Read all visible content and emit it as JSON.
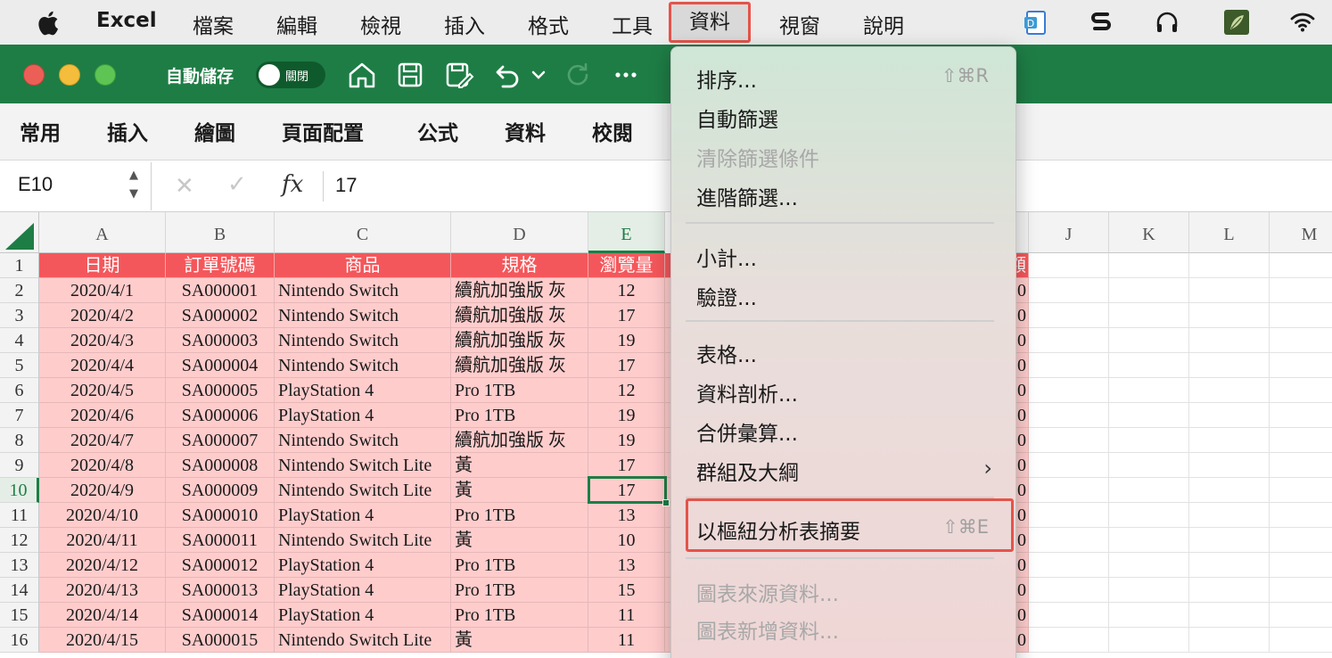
{
  "menubar": {
    "app": "Excel",
    "items": [
      "檔案",
      "編輯",
      "檢視",
      "插入",
      "格式",
      "工具",
      "資料",
      "視窗",
      "說明"
    ],
    "active": "資料"
  },
  "titlebar": {
    "autosave_label": "自動儲存",
    "toggle_label": "關閉"
  },
  "ribbon": {
    "tabs": [
      "常用",
      "插入",
      "繪圖",
      "頁面配置",
      "公式",
      "資料",
      "校閱"
    ]
  },
  "formula_bar": {
    "name_box": "E10",
    "fx": "fx",
    "value": "17"
  },
  "grid": {
    "columns": [
      "A",
      "B",
      "C",
      "D",
      "E",
      "J",
      "K",
      "L",
      "M"
    ],
    "selected_column": "E",
    "selected_row": "10",
    "header_row": [
      "日期",
      "訂單號碼",
      "商品",
      "規格",
      "瀏覽量"
    ],
    "rows": [
      {
        "n": "1"
      },
      {
        "n": "2",
        "cells": [
          "2020/4/1",
          "SA000001",
          "Nintendo Switch",
          "續航加強版 灰",
          "12"
        ]
      },
      {
        "n": "3",
        "cells": [
          "2020/4/2",
          "SA000002",
          "Nintendo Switch",
          "續航加強版 灰",
          "17"
        ]
      },
      {
        "n": "4",
        "cells": [
          "2020/4/3",
          "SA000003",
          "Nintendo Switch",
          "續航加強版 灰",
          "19"
        ]
      },
      {
        "n": "5",
        "cells": [
          "2020/4/4",
          "SA000004",
          "Nintendo Switch",
          "續航加強版 灰",
          "17"
        ]
      },
      {
        "n": "6",
        "cells": [
          "2020/4/5",
          "SA000005",
          "PlayStation 4",
          "Pro 1TB",
          "12"
        ]
      },
      {
        "n": "7",
        "cells": [
          "2020/4/6",
          "SA000006",
          "PlayStation 4",
          "Pro 1TB",
          "19"
        ]
      },
      {
        "n": "8",
        "cells": [
          "2020/4/7",
          "SA000007",
          "Nintendo Switch",
          "續航加強版 灰",
          "19"
        ]
      },
      {
        "n": "9",
        "cells": [
          "2020/4/8",
          "SA000008",
          "Nintendo Switch Lite",
          "黃",
          "17"
        ]
      },
      {
        "n": "10",
        "cells": [
          "2020/4/9",
          "SA000009",
          "Nintendo Switch Lite",
          "黃",
          "17"
        ]
      },
      {
        "n": "11",
        "cells": [
          "2020/4/10",
          "SA000010",
          "PlayStation 4",
          "Pro 1TB",
          "13"
        ]
      },
      {
        "n": "12",
        "cells": [
          "2020/4/11",
          "SA000011",
          "Nintendo Switch Lite",
          "黃",
          "10"
        ]
      },
      {
        "n": "13",
        "cells": [
          "2020/4/12",
          "SA000012",
          "PlayStation 4",
          "Pro 1TB",
          "13"
        ]
      },
      {
        "n": "14",
        "cells": [
          "2020/4/13",
          "SA000013",
          "PlayStation 4",
          "Pro 1TB",
          "15"
        ]
      },
      {
        "n": "15",
        "cells": [
          "2020/4/14",
          "SA000014",
          "PlayStation 4",
          "Pro 1TB",
          "11"
        ]
      },
      {
        "n": "16",
        "cells": [
          "2020/4/15",
          "SA000015",
          "Nintendo Switch Lite",
          "黃",
          "11"
        ]
      }
    ],
    "partial_right_header": "額",
    "partial_right_value": "0"
  },
  "dropdown": {
    "items": [
      {
        "label": "排序...",
        "shortcut": "⇧⌘R",
        "disabled": false
      },
      {
        "label": "自動篩選",
        "disabled": false
      },
      {
        "label": "清除篩選條件",
        "disabled": true
      },
      {
        "label": "進階篩選...",
        "disabled": false
      },
      {
        "label": "小計...",
        "disabled": false
      },
      {
        "label": "驗證...",
        "disabled": false
      },
      {
        "label": "表格...",
        "disabled": false
      },
      {
        "label": "資料剖析...",
        "disabled": false
      },
      {
        "label": "合併彙算...",
        "disabled": false
      },
      {
        "label": "群組及大綱",
        "submenu": true,
        "disabled": false
      },
      {
        "label": "以樞紐分析表摘要",
        "shortcut": "⇧⌘E",
        "disabled": false,
        "highlighted": true
      },
      {
        "label": "圖表來源資料...",
        "disabled": true
      },
      {
        "label": "圖表新增資料...",
        "disabled": true
      }
    ]
  },
  "colors": {
    "excel_green": "#1e7d45",
    "header_red": "#f4575b",
    "row_pink": "#ffcccc",
    "highlight_border": "#e5534b"
  }
}
